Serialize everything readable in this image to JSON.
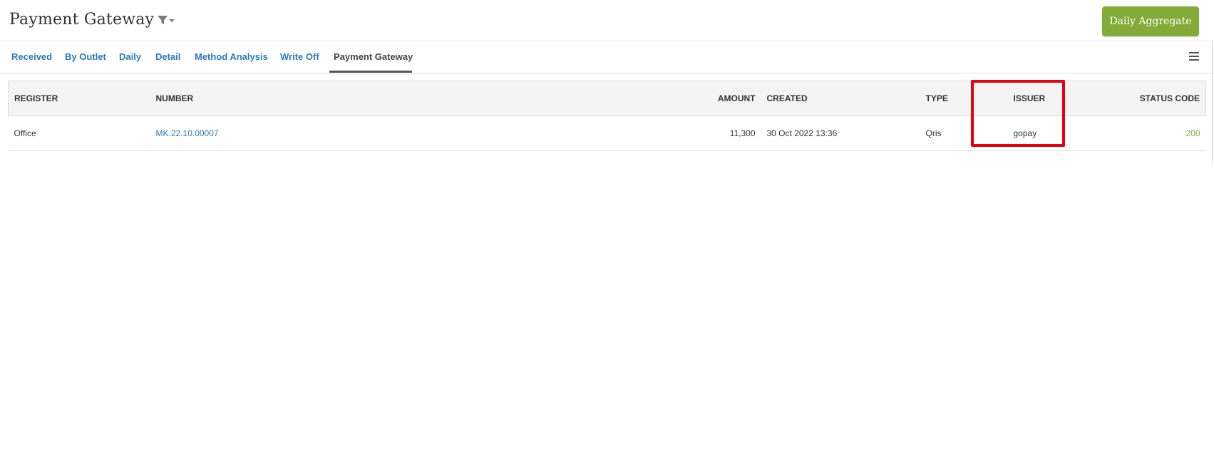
{
  "header": {
    "title": "Payment Gateway",
    "filter_icon": "filter-dropdown-icon",
    "daily_aggregate_label": "Daily Aggregate"
  },
  "tabs": [
    {
      "label": "Received",
      "active": false
    },
    {
      "label": "By Outlet",
      "active": false
    },
    {
      "label": "Daily",
      "active": false
    },
    {
      "label": "Detail",
      "active": false
    },
    {
      "label": "Method Analysis",
      "active": false
    },
    {
      "label": "Write Off",
      "active": false
    },
    {
      "label": "Payment Gateway",
      "active": true
    }
  ],
  "menu_icon": "hamburger-menu-icon",
  "table": {
    "columns": {
      "register": "REGISTER",
      "number": "NUMBER",
      "amount": "AMOUNT",
      "created": "CREATED",
      "type": "TYPE",
      "issuer": "ISSUER",
      "status_code": "STATUS CODE"
    },
    "rows": [
      {
        "register": "Office",
        "number": "MK.22.10.00007",
        "amount": "11,300",
        "created": "30 Oct 2022 13:36",
        "type": "Qris",
        "issuer": "gopay",
        "status_code": "200"
      }
    ]
  },
  "colors": {
    "accent_green": "#84aa38",
    "link_blue": "#2a7ab5",
    "status_green": "#7cb342",
    "highlight_red": "#e8000b"
  }
}
